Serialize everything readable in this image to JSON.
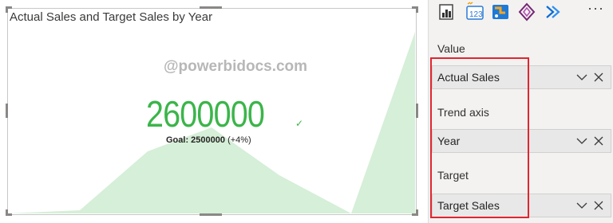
{
  "visual": {
    "title": "Actual Sales and Target Sales by Year",
    "watermark": "@powerbidocs.com",
    "kpi_value": "2600000",
    "goal_label": "Goal: 2500000",
    "goal_delta": "(+4%)",
    "status_color": "#3bb54a",
    "trend_color": "#d6efd8"
  },
  "toolbar": {
    "icons": [
      "bar-chart-icon",
      "card-icon",
      "map-icon",
      "power-apps-icon",
      "power-automate-icon"
    ],
    "more": "···"
  },
  "field_wells": [
    {
      "label": "Value",
      "field": "Actual Sales"
    },
    {
      "label": "Trend axis",
      "field": "Year"
    },
    {
      "label": "Target",
      "field": "Target Sales"
    }
  ],
  "accent_colors": {
    "highlight": "#e0262f",
    "pane_bg": "#f3f2f1"
  }
}
